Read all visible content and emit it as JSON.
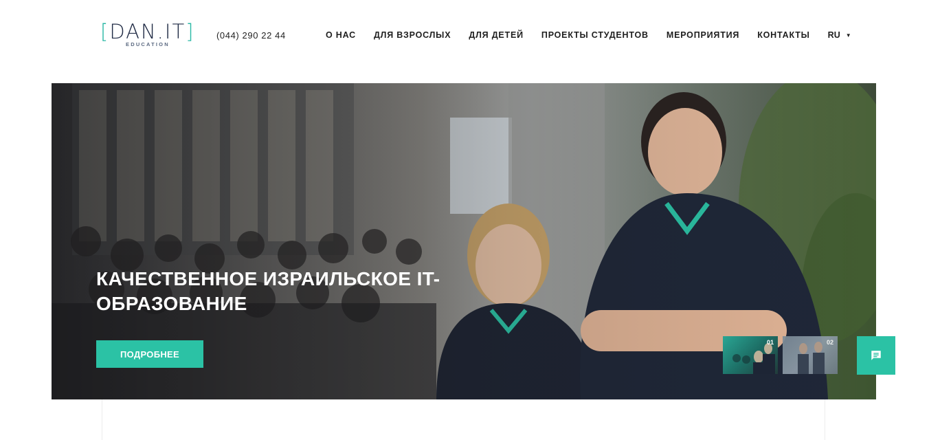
{
  "header": {
    "logo": {
      "main": "DAN.IT",
      "sub": "EDUCATION"
    },
    "phone": "(044) 290 22 44",
    "nav": [
      {
        "label": "О НАС"
      },
      {
        "label": "ДЛЯ ВЗРОСЛЫХ"
      },
      {
        "label": "ДЛЯ ДЕТЕЙ"
      },
      {
        "label": "ПРОЕКТЫ СТУДЕНТОВ"
      },
      {
        "label": "МЕРОПРИЯТИЯ"
      },
      {
        "label": "КОНТАКТЫ"
      }
    ],
    "language": {
      "label": "RU",
      "icon": "caret-down-icon"
    }
  },
  "hero": {
    "title": "КАЧЕСТВЕННОЕ ИЗРАИЛЬСКОЕ IT-ОБРАЗОВАНИЕ",
    "button_label": "ПОДРОБНЕЕ",
    "slides": [
      {
        "number": "01"
      },
      {
        "number": "02"
      }
    ]
  },
  "chat": {
    "icon": "chat-icon"
  },
  "colors": {
    "accent": "#2bc2a5",
    "logo_bracket": "#2bb8a6",
    "text_dark": "#1e1e1e"
  }
}
